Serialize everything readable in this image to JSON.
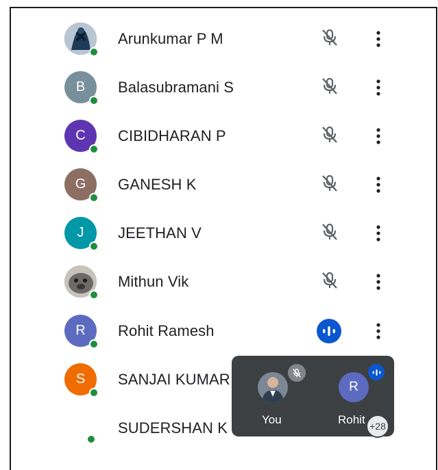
{
  "participants": [
    {
      "name": "Arunkumar P M",
      "avatar_type": "photo",
      "initial": "",
      "avatar_color": "#2f4f6f",
      "mic": "muted"
    },
    {
      "name": "Balasubramani S",
      "avatar_type": "letter",
      "initial": "B",
      "avatar_color": "#78909c",
      "mic": "muted"
    },
    {
      "name": "CIBIDHARAN P",
      "avatar_type": "letter",
      "initial": "C",
      "avatar_color": "#5e35b1",
      "mic": "muted"
    },
    {
      "name": "GANESH K",
      "avatar_type": "letter",
      "initial": "G",
      "avatar_color": "#8d6e63",
      "mic": "muted"
    },
    {
      "name": "JEETHAN V",
      "avatar_type": "letter",
      "initial": "J",
      "avatar_color": "#0097a7",
      "mic": "muted"
    },
    {
      "name": "Mithun Vik",
      "avatar_type": "photo",
      "initial": "",
      "avatar_color": "#9e9e9e",
      "mic": "muted"
    },
    {
      "name": "Rohit Ramesh",
      "avatar_type": "letter",
      "initial": "R",
      "avatar_color": "#5c6bc0",
      "mic": "speaking"
    },
    {
      "name": "SANJAI KUMAR",
      "avatar_type": "letter",
      "initial": "S",
      "avatar_color": "#ef6c00",
      "mic": "hidden"
    },
    {
      "name": "SUDERSHAN K",
      "avatar_type": "none",
      "initial": "",
      "avatar_color": "#ffffff",
      "mic": "hidden"
    }
  ],
  "popup": {
    "you_label": "You",
    "rohit_label": "Rohit",
    "rohit_initial": "R",
    "others_count": "+28"
  },
  "colors": {
    "presence": "#1e8e3e",
    "speaking": "#0b57d0",
    "popup_bg": "#3c4043",
    "mic_icon": "#5f6368"
  }
}
